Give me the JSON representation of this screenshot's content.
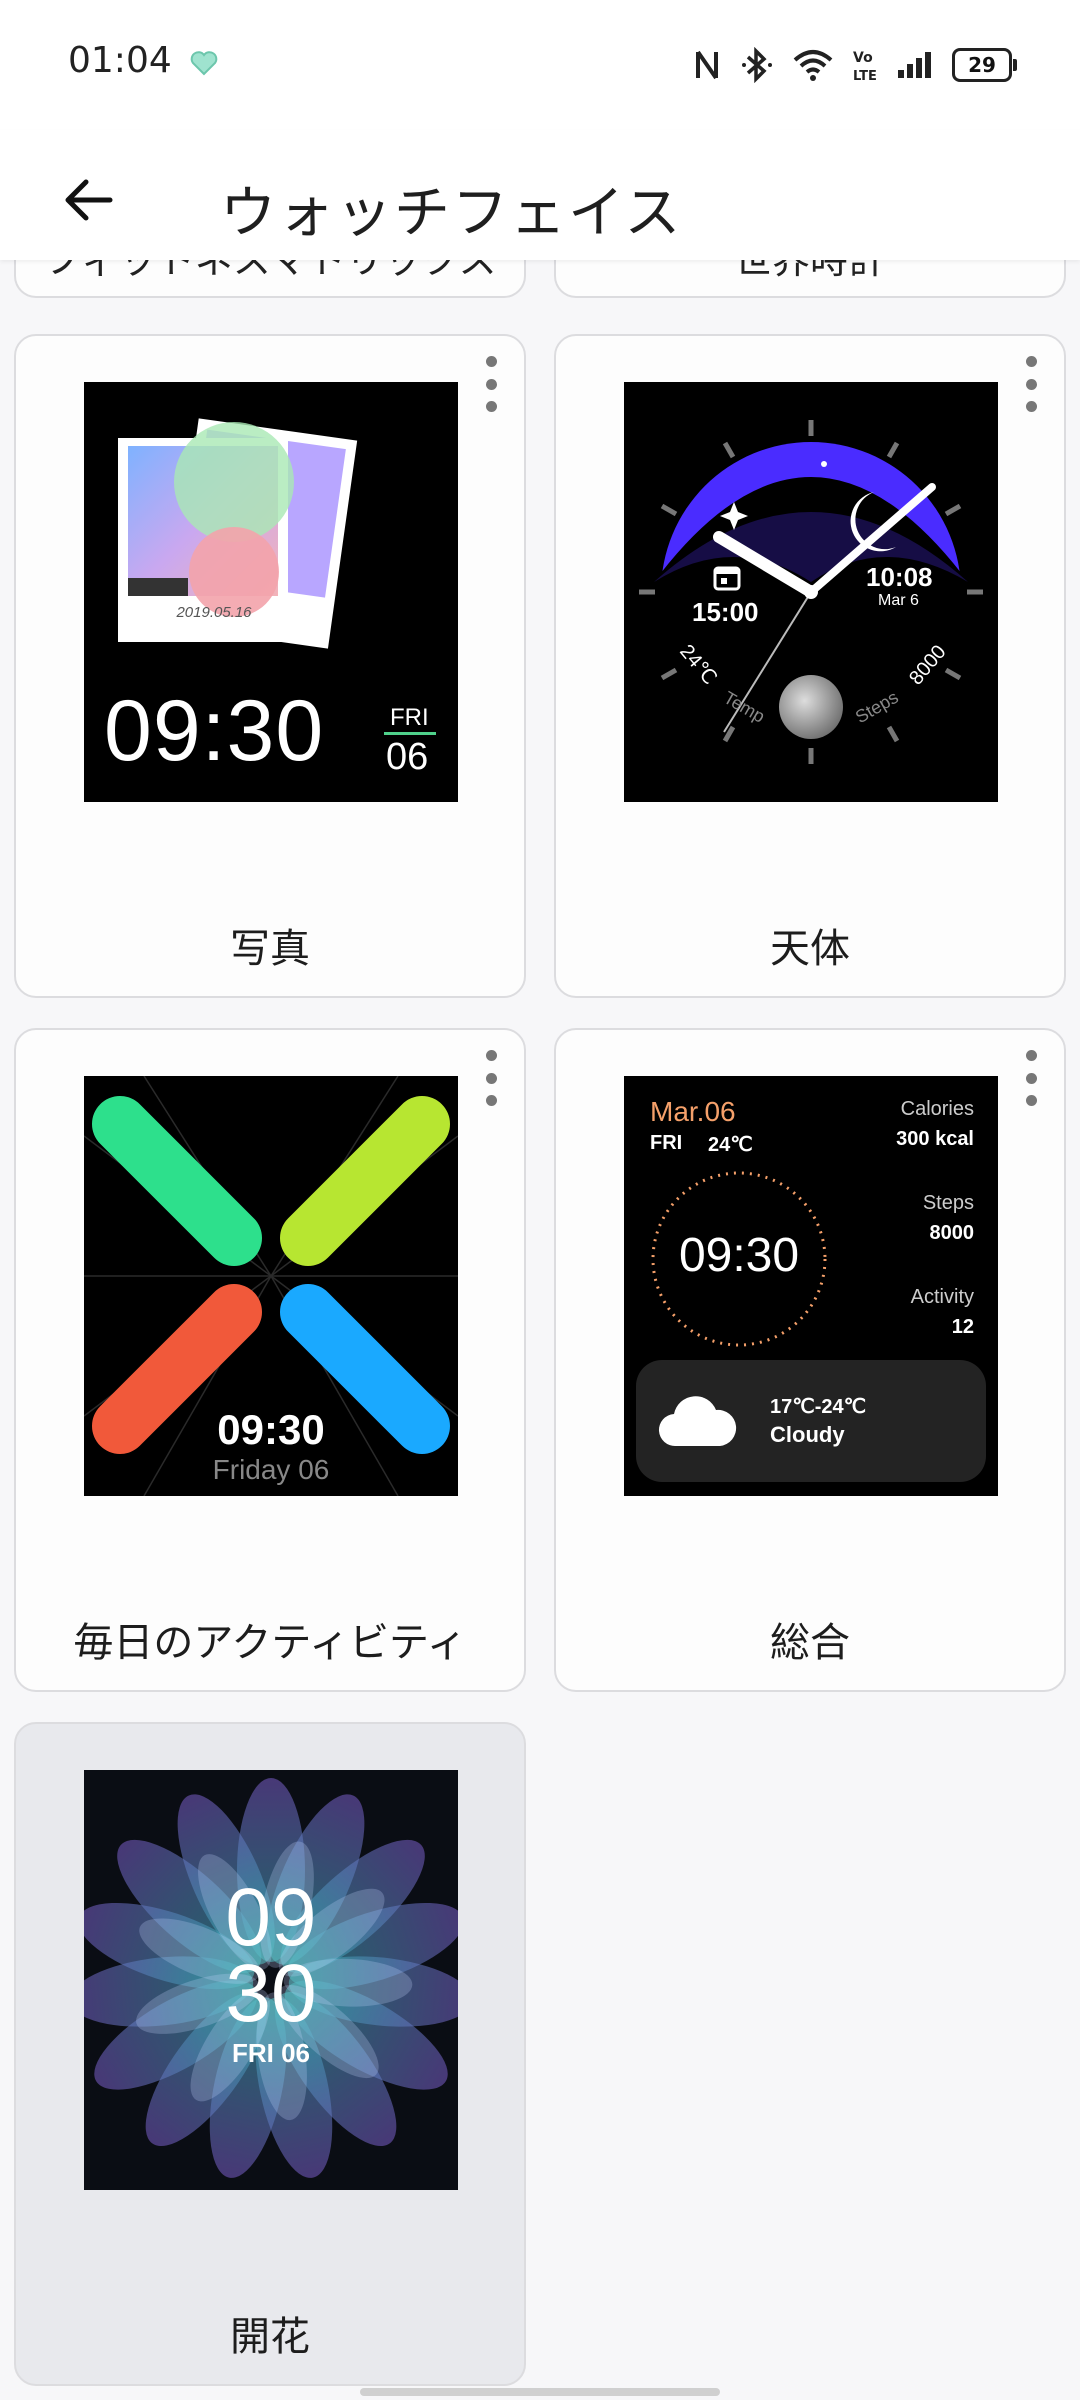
{
  "status_bar": {
    "time": "01:04",
    "battery": "29",
    "icons": [
      "heart-icon",
      "nfc-icon",
      "bluetooth-icon",
      "wifi-icon",
      "volte-icon",
      "signal-icon",
      "battery-icon"
    ]
  },
  "app_bar": {
    "title": "ウォッチフェイス",
    "back_icon": "arrow-left-icon"
  },
  "partial_cards": [
    {
      "label": "フィットネスマトリックス"
    },
    {
      "label": "世界時計"
    }
  ],
  "watch_faces": [
    {
      "label": "写真",
      "face": {
        "photo_date": "2019.05.16",
        "time": "09:30",
        "day": "FRI",
        "date": "06"
      }
    },
    {
      "label": "天体",
      "face": {
        "time_left": "15:00",
        "time_right": "10:08",
        "date": "Mar 6",
        "temp": "24℃",
        "temp_label": "Temp",
        "steps_label": "Steps",
        "steps": "8000"
      }
    },
    {
      "label": "毎日のアクティビティ",
      "face": {
        "time": "09:30",
        "date": "Friday 06"
      }
    },
    {
      "label": "総合",
      "face": {
        "date": "Mar.06",
        "day": "FRI",
        "temp": "24℃",
        "time": "09:30",
        "calories_label": "Calories",
        "calories": "300 kcal",
        "steps_label": "Steps",
        "steps": "8000",
        "activity_label": "Activity",
        "activity": "12",
        "weather_range": "17℃-24℃",
        "weather": "Cloudy"
      }
    },
    {
      "label": "開花",
      "selected": true,
      "face": {
        "hour": "09",
        "minute": "30",
        "date": "FRI 06"
      }
    }
  ],
  "colors": {
    "background": "#f7f7f9",
    "card_border": "#dcdcdf",
    "selected_card": "#e8e9ed",
    "accent_orange": "#f5a06a"
  }
}
